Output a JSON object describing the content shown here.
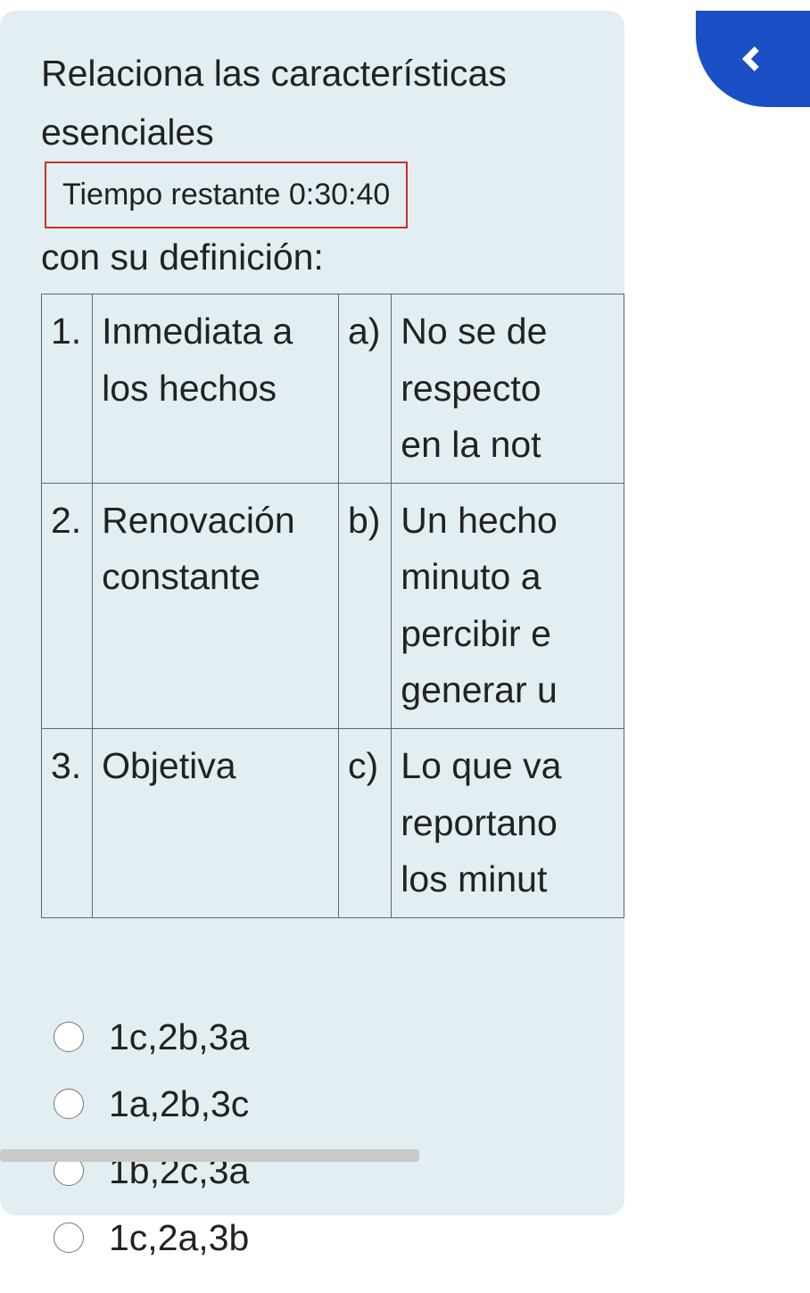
{
  "question": {
    "prefix": "Relaciona las características esenciales",
    "suffix": "con su definición:"
  },
  "timer": {
    "label": "Tiempo restante 0:30:40"
  },
  "table": {
    "rows": [
      {
        "num": "1.",
        "term": "Inmediata a los hechos",
        "let": "a)",
        "def": "No se de respecto en la not"
      },
      {
        "num": "2.",
        "term": "Renovación constante",
        "let": "b)",
        "def": "Un hecho minuto a percibir e generar u"
      },
      {
        "num": "3.",
        "term": "Objetiva",
        "let": "c)",
        "def": "Lo que va reportano los minut"
      }
    ]
  },
  "options": [
    "1c,2b,3a",
    "1a,2b,3c",
    "1b,2c,3a",
    "1c,2a,3b"
  ]
}
